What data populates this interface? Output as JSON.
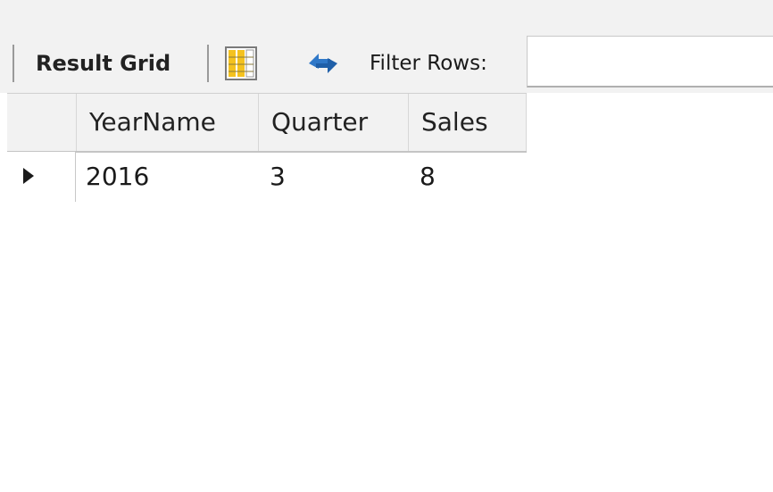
{
  "toolbar": {
    "result_grid_label": "Result Grid",
    "filter_label": "Filter Rows:",
    "filter_value": "",
    "grid_icon": "column-grid-icon",
    "refresh_icon": "refresh-icon"
  },
  "grid": {
    "columns": [
      "YearName",
      "Quarter",
      "Sales"
    ],
    "rows": [
      [
        "2016",
        "3",
        "8"
      ]
    ]
  },
  "colors": {
    "toolbar_bg": "#f2f2f2",
    "grid_icon_yellow": "#f4c21f",
    "refresh_blue": "#2f78c8"
  }
}
